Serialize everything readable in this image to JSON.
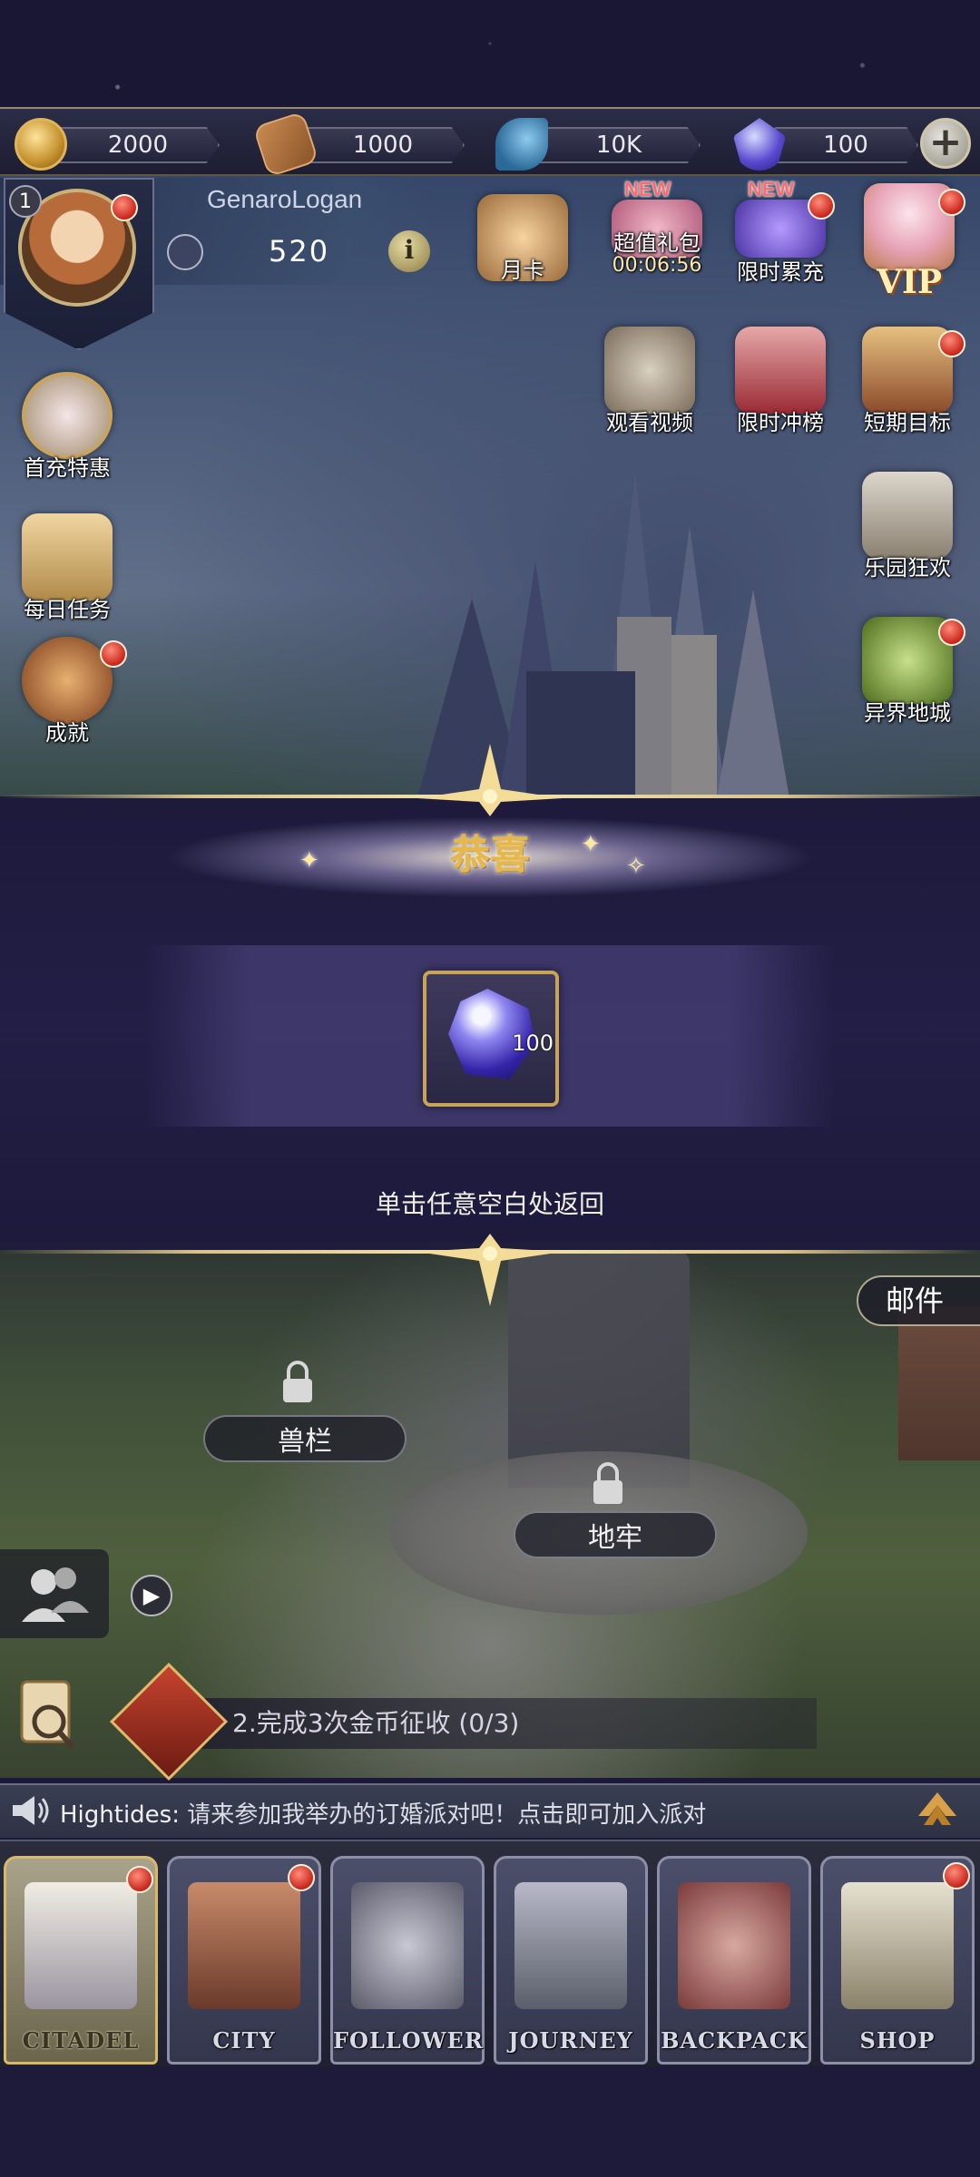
{
  "resources": {
    "gold": "2000",
    "wood": "1000",
    "feather": "10K",
    "gems": "100"
  },
  "player": {
    "level": "1",
    "name": "GenaroLogan",
    "power": "520"
  },
  "features": {
    "monthly_card": "月卡",
    "value_pack": "超值礼包",
    "value_pack_timer": "00:06:56",
    "limited_topup": "限时累充",
    "new_tag": "NEW",
    "vip": "VIP",
    "watch_video": "观看视频",
    "limited_rank": "限时冲榜",
    "short_goal": "短期目标",
    "paradise_carnival": "乐园狂欢",
    "otherworld_dungeon": "异界地城",
    "first_recharge": "首充特惠",
    "daily_tasks": "每日任务",
    "achievements": "成就"
  },
  "modal": {
    "title": "恭喜",
    "reward_qty": "100",
    "hint": "单击任意空白处返回"
  },
  "city": {
    "pen_label": "兽栏",
    "dungeon_label": "地牢",
    "mail_label": "邮件",
    "quest_text": "2.完成3次金币征收 (0/3)"
  },
  "chat": {
    "sender": "Hightides:",
    "message": "请来参加我举办的订婚派对吧！点击即可加入派对"
  },
  "nav": [
    {
      "label": "CITADEL",
      "active": true
    },
    {
      "label": "CITY",
      "active": false
    },
    {
      "label": "FOLLOWER",
      "active": false
    },
    {
      "label": "JOURNEY",
      "active": false
    },
    {
      "label": "BACKPACK",
      "active": false
    },
    {
      "label": "SHOP",
      "active": false
    }
  ],
  "colors": {
    "accent_gold": "#d8b96a",
    "badge_red": "#c8261c",
    "new_tag": "#ff6a6a"
  }
}
